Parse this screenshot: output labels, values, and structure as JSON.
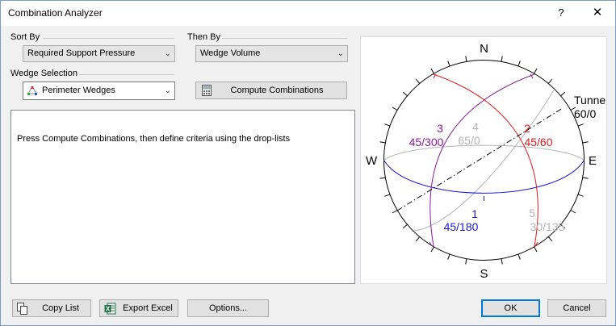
{
  "window": {
    "title": "Combination Analyzer",
    "help_glyph": "?",
    "close_glyph": "✕"
  },
  "sort_by": {
    "label": "Sort By",
    "value": "Required Support Pressure"
  },
  "then_by": {
    "label": "Then By",
    "value": "Wedge Volume"
  },
  "wedge_selection": {
    "label": "Wedge Selection",
    "value": "Perimeter Wedges"
  },
  "compute_button": "Compute Combinations",
  "message": "Press Compute Combinations, then define criteria using the drop-lists",
  "bottom_buttons": {
    "copy_list": "Copy List",
    "export_excel": "Export Excel",
    "options": "Options...",
    "ok": "OK",
    "cancel": "Cancel"
  },
  "stereonet": {
    "north": "N",
    "south": "S",
    "east": "E",
    "west": "W",
    "tunnel_label": "Tunne",
    "tunnel_orientation": "60/0",
    "planes": [
      {
        "id": "1",
        "orientation": "45/180",
        "color": "#1a1acc"
      },
      {
        "id": "2",
        "orientation": "45/60",
        "color": "#e01a1a"
      },
      {
        "id": "3",
        "orientation": "45/300",
        "color": "#8a1a9a"
      },
      {
        "id": "4",
        "orientation": "65/0",
        "color": "#b4b4b4"
      },
      {
        "id": "5",
        "orientation": "30/135",
        "color": "#b4b4b4"
      }
    ]
  }
}
